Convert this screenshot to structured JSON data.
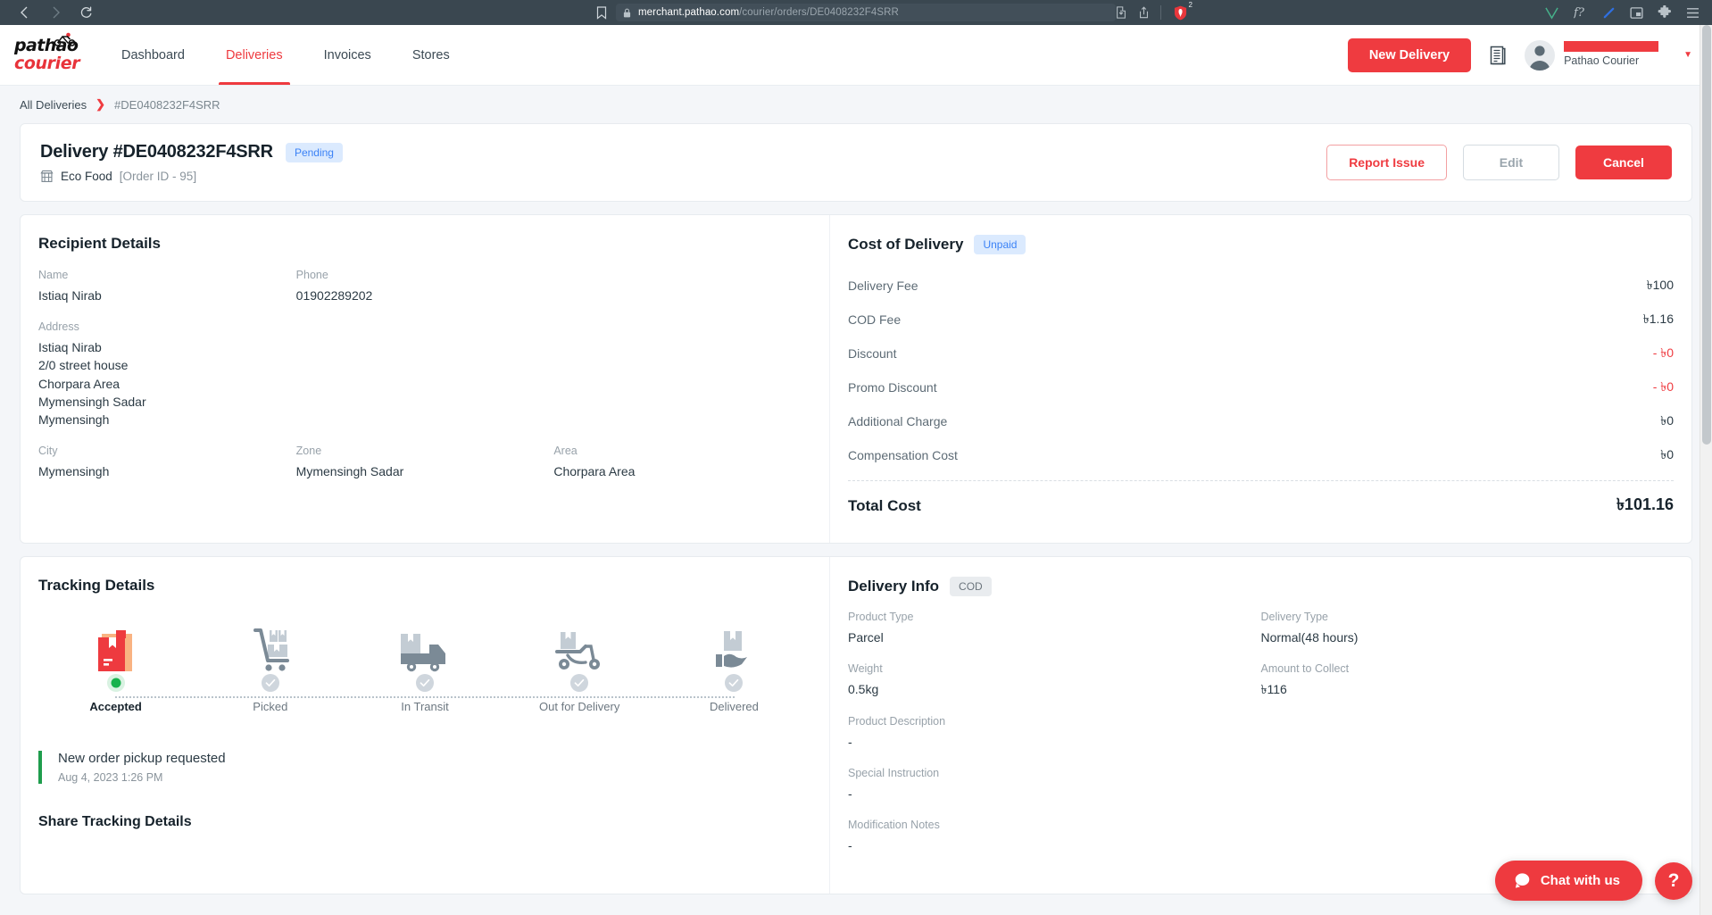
{
  "browser": {
    "back_icon": "back-arrow-icon",
    "forward_icon": "forward-arrow-icon",
    "reload_icon": "reload-icon",
    "bookmark_icon": "bookmark-icon",
    "lock_icon": "lock-icon",
    "url_host": "merchant.pathao.com",
    "url_path": "/courier/orders/DE0408232F4SRR",
    "url_full": "merchant.pathao.com/courier/orders/DE0408232F4SRR",
    "extension_badge_count": "2",
    "icons": [
      "install-icon",
      "share-icon",
      "shield-extension-icon",
      "v-extension-icon",
      "f-question-extension-icon",
      "pen-extension-icon",
      "picture-in-picture-icon",
      "puzzle-extensions-icon",
      "hamburger-menu-icon"
    ]
  },
  "header": {
    "logo_top": "pathao",
    "logo_bottom": "courier",
    "nav": [
      {
        "label": "Dashboard",
        "active": false
      },
      {
        "label": "Deliveries",
        "active": true
      },
      {
        "label": "Invoices",
        "active": false
      },
      {
        "label": "Stores",
        "active": false
      }
    ],
    "new_delivery_label": "New Delivery",
    "doc_icon": "document-list-icon",
    "avatar_icon": "user-avatar-icon",
    "user_name": "",
    "user_role": "Pathao Courier",
    "caret_icon": "chevron-down-icon"
  },
  "breadcrumb": {
    "root": "All Deliveries",
    "separator": "❯",
    "current": "#DE0408232F4SRR"
  },
  "title_card": {
    "title": "Delivery #DE0408232F4SRR",
    "status_badge": "Pending",
    "store_icon": "store-icon",
    "store_name": "Eco Food",
    "order_id": "[Order ID - 95]",
    "actions": {
      "report_issue": "Report Issue",
      "edit": "Edit",
      "cancel": "Cancel"
    }
  },
  "recipient": {
    "title": "Recipient Details",
    "name_label": "Name",
    "name_value": "Istiaq Nirab",
    "phone_label": "Phone",
    "phone_value": "01902289202",
    "address_label": "Address",
    "address_lines": [
      "Istiaq Nirab",
      "2/0 street house",
      "Chorpara Area",
      "Mymensingh Sadar",
      "Mymensingh"
    ],
    "city_label": "City",
    "city_value": "Mymensingh",
    "zone_label": "Zone",
    "zone_value": "Mymensingh Sadar",
    "area_label": "Area",
    "area_value": "Chorpara Area"
  },
  "cost": {
    "title": "Cost of Delivery",
    "badge": "Unpaid",
    "rows": [
      {
        "label": "Delivery Fee",
        "value": "৳100",
        "negative": false
      },
      {
        "label": "COD Fee",
        "value": "৳1.16",
        "negative": false
      },
      {
        "label": "Discount",
        "value": "- ৳0",
        "negative": true
      },
      {
        "label": "Promo Discount",
        "value": "- ৳0",
        "negative": true
      },
      {
        "label": "Additional Charge",
        "value": "৳0",
        "negative": false
      },
      {
        "label": "Compensation Cost",
        "value": "৳0",
        "negative": false
      }
    ],
    "total_label": "Total Cost",
    "total_value": "৳101.16"
  },
  "tracking": {
    "title": "Tracking Details",
    "steps": [
      {
        "label": "Accepted",
        "icon": "package-accepted-icon",
        "state": "current"
      },
      {
        "label": "Picked",
        "icon": "hand-trolley-icon",
        "state": "pending"
      },
      {
        "label": "In Transit",
        "icon": "delivery-truck-icon",
        "state": "pending"
      },
      {
        "label": "Out for Delivery",
        "icon": "scooter-icon",
        "state": "pending"
      },
      {
        "label": "Delivered",
        "icon": "package-handover-icon",
        "state": "pending"
      }
    ],
    "event_title": "New order pickup requested",
    "event_time": "Aug 4, 2023 1:26 PM",
    "share_title": "Share Tracking Details"
  },
  "delivery_info": {
    "title": "Delivery Info",
    "badge": "COD",
    "fields": [
      {
        "label": "Product Type",
        "value": "Parcel",
        "full": false
      },
      {
        "label": "Delivery Type",
        "value": "Normal(48 hours)",
        "full": false
      },
      {
        "label": "Weight",
        "value": "0.5kg",
        "full": false
      },
      {
        "label": "Amount to Collect",
        "value": "৳116",
        "full": false
      },
      {
        "label": "Product Description",
        "value": "-",
        "full": true
      },
      {
        "label": "Special Instruction",
        "value": "-",
        "full": true
      },
      {
        "label": "Modification Notes",
        "value": "-",
        "full": true
      }
    ]
  },
  "chat": {
    "label": "Chat with us",
    "icon": "chat-bubble-icon",
    "help_label": "?"
  },
  "colors": {
    "brand_red": "#ef3b40",
    "badge_blue_bg": "#dbeafe",
    "badge_blue_text": "#3b82f6",
    "green": "#1f9d4d",
    "page_bg": "#f4f6f9"
  }
}
